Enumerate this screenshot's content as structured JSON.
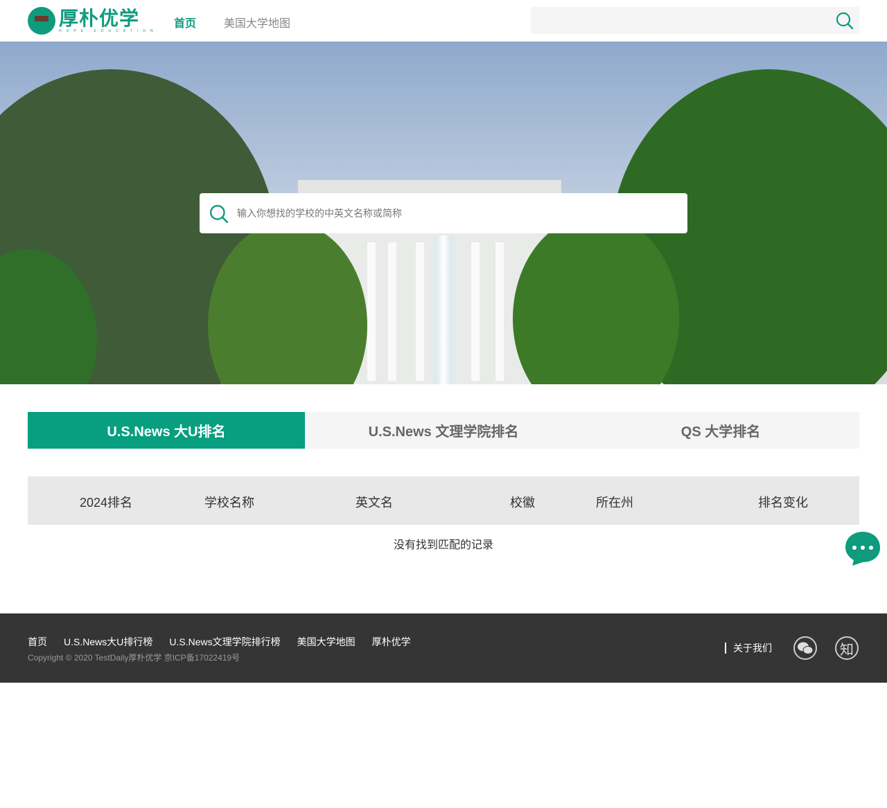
{
  "header": {
    "logo_cn": "厚朴优学",
    "logo_en": "HOPE EDUCATION",
    "nav": [
      {
        "label": "首页"
      },
      {
        "label": "美国大学地图"
      }
    ]
  },
  "hero": {
    "search_placeholder": "输入你想找的学校的中英文名称或简称"
  },
  "tabs": [
    {
      "label": "U.S.News 大U排名"
    },
    {
      "label": "U.S.News 文理学院排名"
    },
    {
      "label": "QS 大学排名"
    }
  ],
  "table": {
    "headers": [
      "2024排名",
      "学校名称",
      "英文名",
      "校徽",
      "所在州",
      "排名变化"
    ],
    "empty": "没有找到匹配的记录"
  },
  "footer": {
    "links": [
      "首页",
      "U.S.News大U排行榜",
      "U.S.News文理学院排行榜",
      "美国大学地图",
      "厚朴优学"
    ],
    "copyright": "Copyright © 2020 TestDaily厚朴优学 京ICP备17022419号",
    "about": "关于我们",
    "zhihu": "知"
  },
  "colors": {
    "accent": "#079f7f",
    "footer": "#353535"
  }
}
